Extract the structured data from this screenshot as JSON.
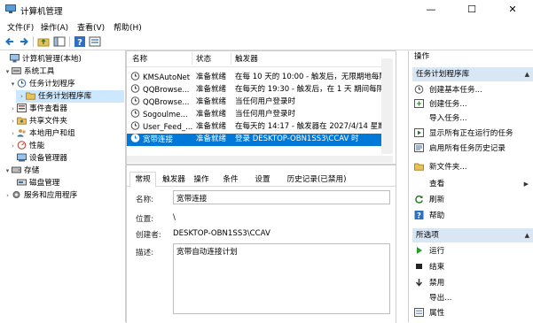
{
  "window": {
    "title": "计算机管理",
    "minimize": "—",
    "maximize": "☐",
    "close": "✕"
  },
  "menu": [
    "文件(F)",
    "操作(A)",
    "查看(V)",
    "帮助(H)"
  ],
  "toolbar_icons": [
    "back-icon",
    "forward-icon",
    "up-folder-icon",
    "show-hide-tree-icon",
    "help-icon",
    "properties-icon"
  ],
  "tree": [
    {
      "label": "计算机管理(本地)",
      "icon": "computer-icon",
      "twisty": ""
    },
    {
      "label": "系统工具",
      "icon": "tools-icon",
      "twisty": "▾"
    },
    {
      "label": "任务计划程序",
      "icon": "clock-icon",
      "twisty": "▾"
    },
    {
      "label": "任务计划程序库",
      "icon": "folder-icon",
      "twisty": "›"
    },
    {
      "label": "事件查看器",
      "icon": "event-viewer-icon",
      "twisty": "›"
    },
    {
      "label": "共享文件夹",
      "icon": "shared-folder-icon",
      "twisty": "›"
    },
    {
      "label": "本地用户和组",
      "icon": "users-icon",
      "twisty": "›"
    },
    {
      "label": "性能",
      "icon": "performance-icon",
      "twisty": "›"
    },
    {
      "label": "设备管理器",
      "icon": "device-manager-icon",
      "twisty": ""
    },
    {
      "label": "存储",
      "icon": "storage-icon",
      "twisty": "▾"
    },
    {
      "label": "磁盘管理",
      "icon": "disk-icon",
      "twisty": ""
    },
    {
      "label": "服务和应用程序",
      "icon": "services-icon",
      "twisty": "›"
    }
  ],
  "task_list": {
    "columns": [
      "名称",
      "状态",
      "触发器"
    ],
    "rows": [
      {
        "name": "KMSAutoNet",
        "status": "准备就绪",
        "trigger": "在每 10 天的 10:00 - 触发后，无限期地每隔 1"
      },
      {
        "name": "QQBrowse...",
        "status": "准备就绪",
        "trigger": "在每天的 19:30 - 触发后，在 1 天 期间每隔 1"
      },
      {
        "name": "QQBrowse...",
        "status": "准备就绪",
        "trigger": "当任何用户登录时"
      },
      {
        "name": "Sogoulme...",
        "status": "准备就绪",
        "trigger": "当任何用户登录时"
      },
      {
        "name": "User_Feed_...",
        "status": "准备就绪",
        "trigger": "在每天的 14:17 - 触发器在 2027/4/14 星期三"
      },
      {
        "name": "宽带连接",
        "status": "准备就绪",
        "trigger": "登录 DESKTOP-OBN1SS3\\CCAV 时"
      }
    ]
  },
  "details": {
    "tabs": [
      "常规",
      "触发器",
      "操作",
      "条件",
      "设置",
      "历史记录(已禁用)"
    ],
    "name_label": "名称:",
    "name_value": "宽带连接",
    "location_label": "位置:",
    "location_value": "\\",
    "author_label": "创建者:",
    "author_value": "DESKTOP-OBN1SS3\\CCAV",
    "description_label": "描述:",
    "description_value": "宽带自动连接计划"
  },
  "actions": {
    "header": "操作",
    "section1": "任务计划程序库",
    "section1_items": [
      {
        "label": "创建基本任务...",
        "icon": "create-basic-task-icon"
      },
      {
        "label": "创建任务...",
        "icon": "create-task-icon"
      },
      {
        "label": "导入任务...",
        "icon": ""
      },
      {
        "label": "显示所有正在运行的任务",
        "icon": "running-tasks-icon"
      },
      {
        "label": "启用所有任务历史记录",
        "icon": "history-icon"
      },
      {
        "label": "新文件夹...",
        "icon": "new-folder-icon"
      },
      {
        "label": "查看",
        "icon": "",
        "submenu": true
      },
      {
        "label": "刷新",
        "icon": "refresh-icon"
      },
      {
        "label": "帮助",
        "icon": "help-icon"
      }
    ],
    "section2": "所选项",
    "section2_items": [
      {
        "label": "运行",
        "icon": "run-icon"
      },
      {
        "label": "结束",
        "icon": "end-icon"
      },
      {
        "label": "禁用",
        "icon": "disable-icon"
      },
      {
        "label": "导出...",
        "icon": ""
      },
      {
        "label": "属性",
        "icon": "properties-icon"
      }
    ]
  },
  "colors": {
    "selection": "#0078d7",
    "tree_selection": "#cce8ff",
    "action_section": "#d9e7f5"
  }
}
